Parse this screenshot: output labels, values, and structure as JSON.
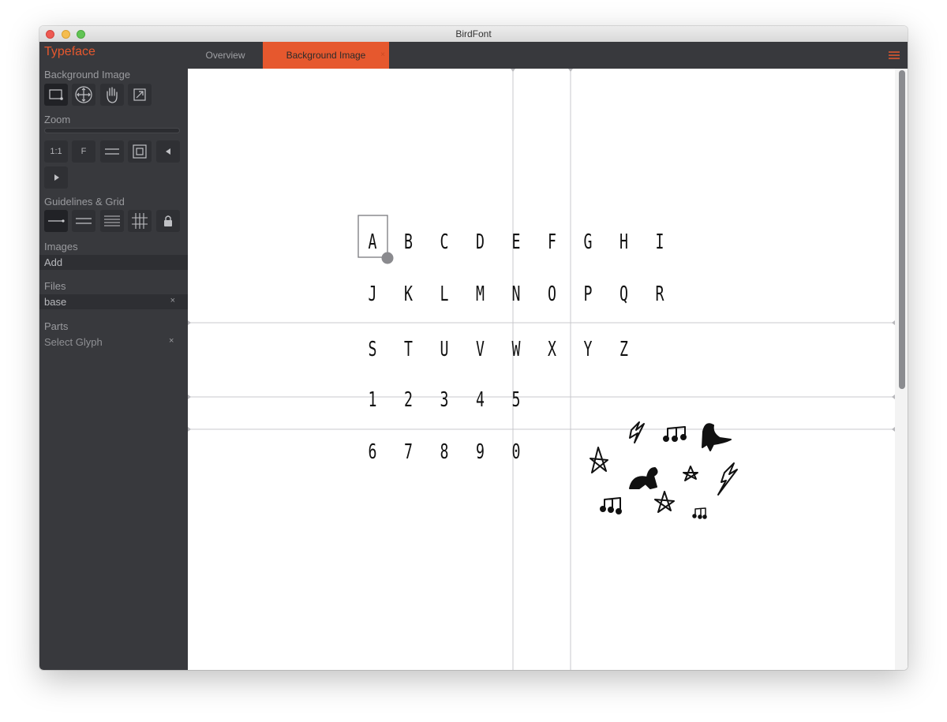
{
  "window": {
    "title": "BirdFont"
  },
  "sidebar": {
    "title": "Typeface",
    "sections": {
      "background_image": "Background Image",
      "zoom": "Zoom",
      "guidelines": "Guidelines & Grid",
      "images": "Images",
      "files": "Files",
      "parts": "Parts"
    },
    "zoom_tools": {
      "one_to_one": "1:1",
      "fit": "F"
    },
    "images": {
      "add": "Add"
    },
    "files": {
      "item": "base",
      "remove": "×"
    },
    "parts": {
      "item": "Select Glyph",
      "remove": "×"
    }
  },
  "tabs": [
    {
      "label": "Overview",
      "active": false
    },
    {
      "label": "Background Image",
      "active": true,
      "close": "×"
    }
  ],
  "canvas": {
    "glyph_rows": [
      [
        "A",
        "B",
        "C",
        "D",
        "E",
        "F",
        "G",
        "H",
        "I"
      ],
      [
        "J",
        "K",
        "L",
        "M",
        "N",
        "O",
        "P",
        "Q",
        "R"
      ],
      [
        "S",
        "T",
        "U",
        "V",
        "W",
        "X",
        "Y",
        "Z"
      ],
      [
        "1",
        "2",
        "3",
        "4",
        "5"
      ],
      [
        "6",
        "7",
        "8",
        "9",
        "0"
      ]
    ],
    "selected_glyph": "A",
    "doodle_icons": [
      "bolt-icon",
      "music-note-icon",
      "dinosaur-icon",
      "star-icon",
      "dinosaur-icon",
      "star-icon",
      "bolt-icon",
      "music-note-icon",
      "star-icon",
      "music-note-icon",
      "star-icon",
      "bolt-icon"
    ]
  },
  "colors": {
    "accent": "#e6582e",
    "sidebar_bg": "#38393d",
    "tool_bg": "#2f3034",
    "guide_line": "#c8c8cc"
  }
}
